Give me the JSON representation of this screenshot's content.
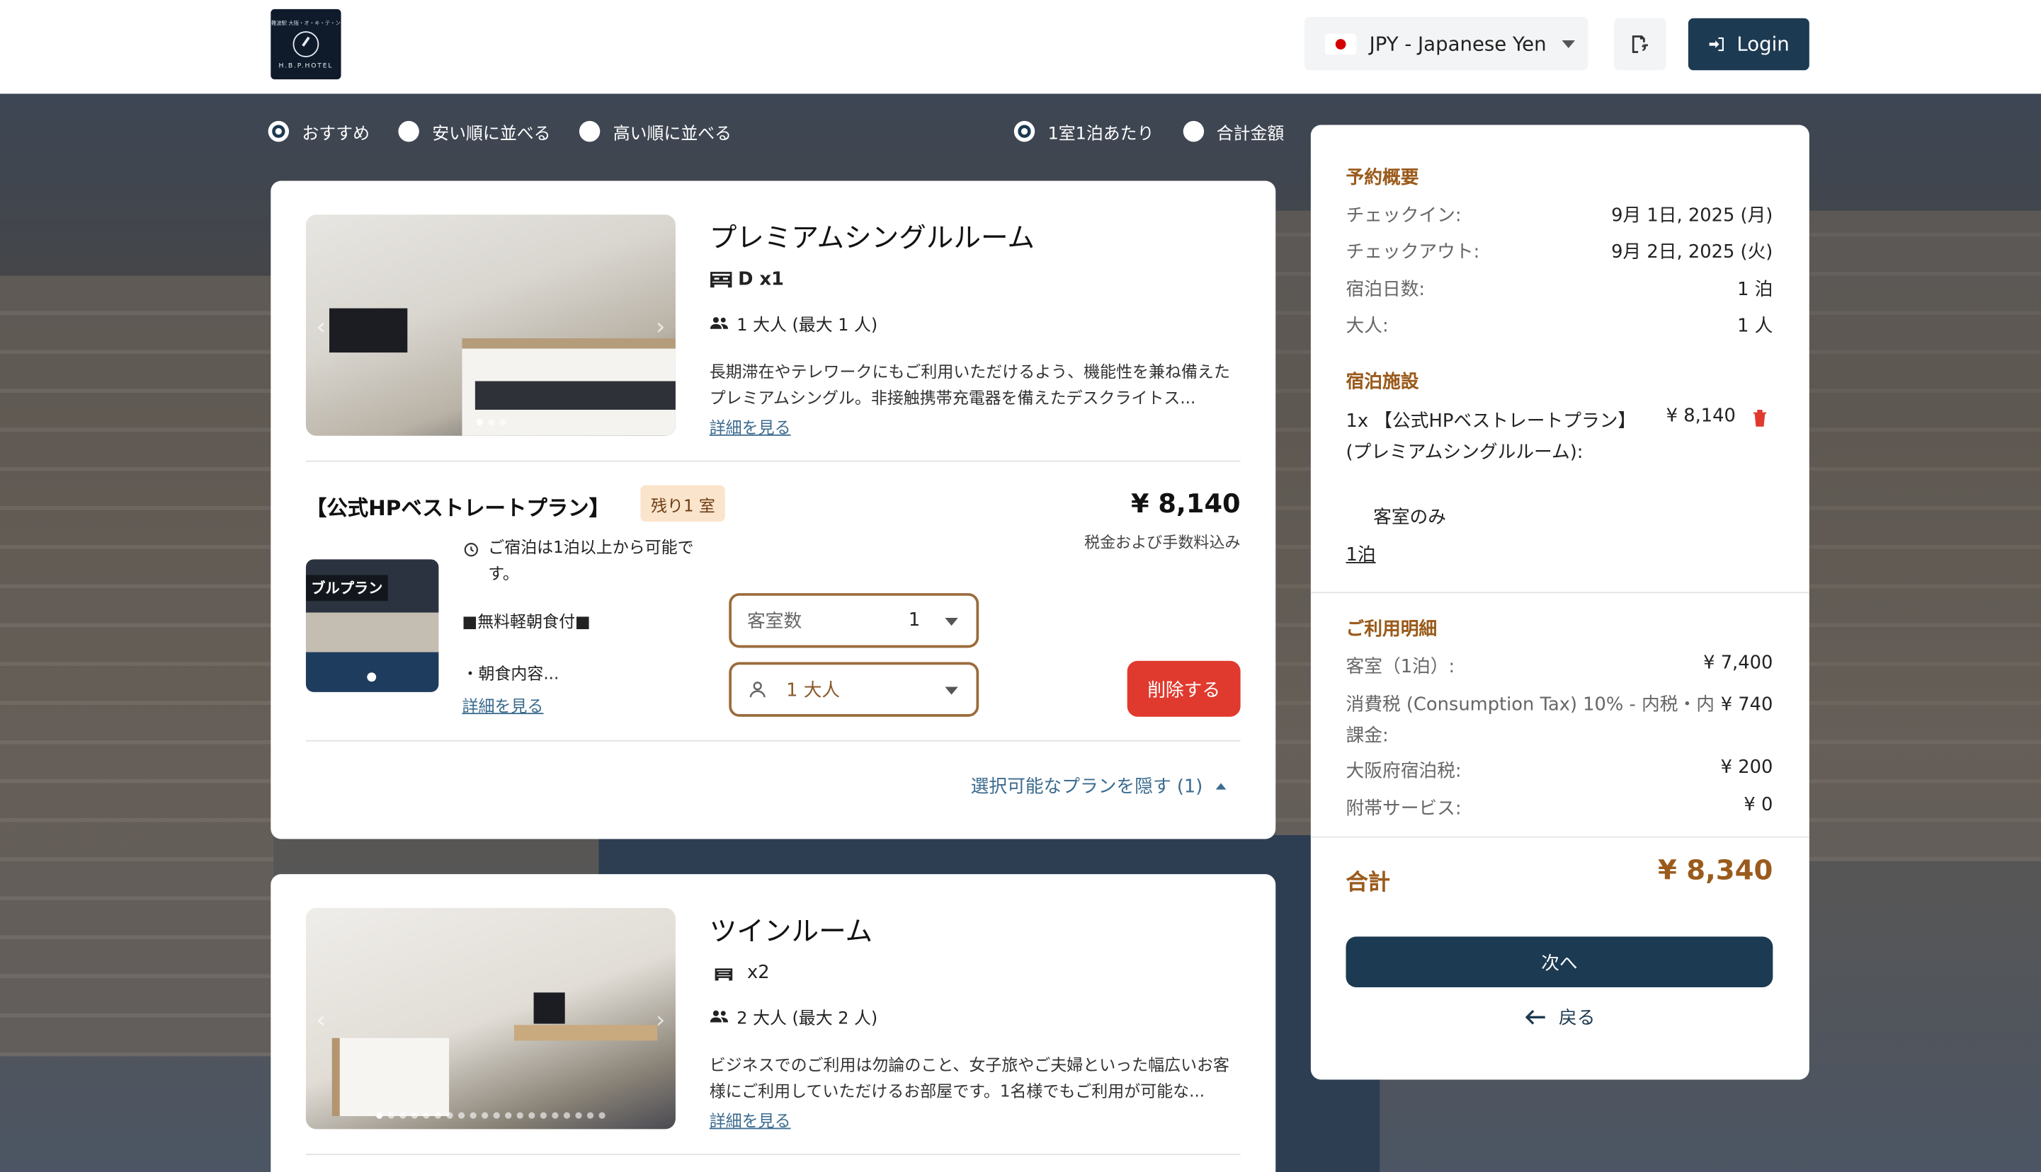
{
  "header": {
    "logo_jp": "難波駅 大阪・オ・キ・テ・ン",
    "logo_en": "H.B.P.HOTEL",
    "currency_label": "JPY - Japanese Yen",
    "login_label": "Login"
  },
  "sort": {
    "options": [
      "おすすめ",
      "安い順に並べる",
      "高い順に並べる"
    ],
    "selected": 0,
    "price_modes": [
      "1室1泊あたり",
      "合計金額"
    ],
    "price_mode_selected": 0
  },
  "rooms": [
    {
      "name": "プレミアムシングルルーム",
      "bed": "D x1",
      "guests": "1 大人 (最大 1 人)",
      "description": "長期滞在やテレワークにもご利用いただけるよう、機能性を兼ね備えたプレミアムシングル。非接触携帯充電器を備えたデスクライトス...",
      "more_link": "詳細を見る",
      "plan": {
        "name": "【公式HPベストレートプラン】",
        "badge": "残り1 室",
        "price": "¥ 8,140",
        "tax_note": "税金および手数料込み",
        "image_tag": "ブルプラン",
        "notice": "ご宿泊は1泊以上から可能です。",
        "breakfast": "■無料軽朝食付■",
        "breakfast_detail": "・朝食内容...",
        "more_link": "詳細を見る",
        "rooms_label": "客室数",
        "rooms_value": "1",
        "guests_value": "1 大人",
        "delete_label": "削除する"
      },
      "hide_plans": "選択可能なプランを隠す (1)"
    },
    {
      "name": "ツインルーム",
      "bed": "x2",
      "guests": "2 大人 (最大 2 人)",
      "description": "ビジネスでのご利用は勿論のこと、女子旅やご夫婦といった幅広いお客様にご利用していただけるお部屋です。1名様でもご利用が可能な...",
      "more_link": "詳細を見る"
    }
  ],
  "summary": {
    "title": "予約概要",
    "checkin_label": "チェックイン:",
    "checkin_value": "9月 1日, 2025 (月)",
    "checkout_label": "チェックアウト:",
    "checkout_value": "9月 2日, 2025 (火)",
    "nights_label": "宿泊日数:",
    "nights_value": "1 泊",
    "adults_label": "大人:",
    "adults_value": "1 人",
    "stay_title": "宿泊施設",
    "stay_line": "1x 【公式HPベストレートプラン】 (プレミアムシングルルーム):",
    "stay_price": "¥ 8,140",
    "stay_sub": "客室のみ",
    "stay_nights": "1泊",
    "breakdown_title": "ご利用明細",
    "room_label": "客室（1泊）:",
    "room_value": "¥ 7,400",
    "tax_label": "消費税 (Consumption Tax) 10% - 内税・内課金:",
    "tax_value": "¥ 740",
    "city_tax_label": "大阪府宿泊税:",
    "city_tax_value": "¥ 200",
    "service_label": "附帯サービス:",
    "service_value": "¥ 0",
    "total_label": "合計",
    "total_value": "¥ 8,340",
    "next_label": "次へ",
    "back_label": "戻る"
  }
}
